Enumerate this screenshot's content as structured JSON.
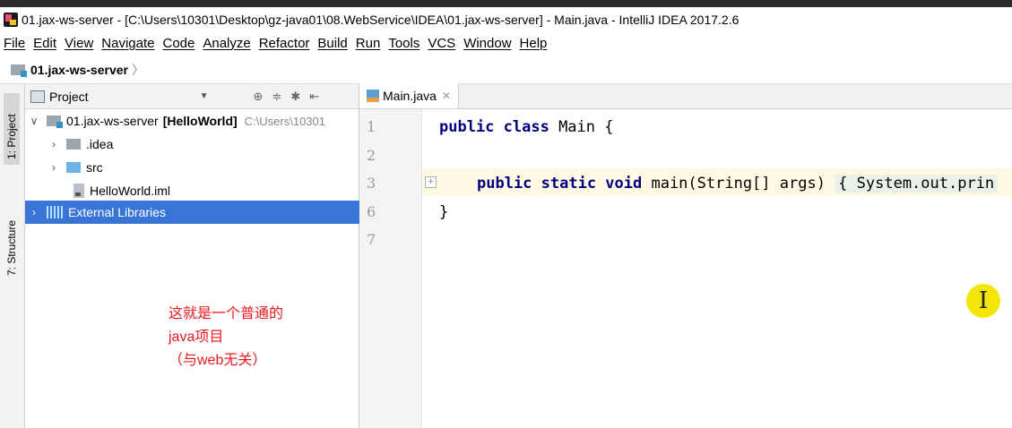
{
  "window": {
    "title": "01.jax-ws-server - [C:\\Users\\10301\\Desktop\\gz-java01\\08.WebService\\IDEA\\01.jax-ws-server] - Main.java - IntelliJ IDEA 2017.2.6"
  },
  "menu": [
    "File",
    "Edit",
    "View",
    "Navigate",
    "Code",
    "Analyze",
    "Refactor",
    "Build",
    "Run",
    "Tools",
    "VCS",
    "Window",
    "Help"
  ],
  "navbar": {
    "crumb": "01.jax-ws-server"
  },
  "left_toolbar": {
    "project_tab": "1: Project",
    "structure_tab": "7: Structure"
  },
  "project_panel": {
    "title": "Project",
    "tree": {
      "root_name": "01.jax-ws-server",
      "root_module": "[HelloWorld]",
      "root_path": "C:\\Users\\10301",
      "idea": ".idea",
      "src": "src",
      "iml": "HelloWorld.iml",
      "libs": "External Libraries"
    }
  },
  "annotation": {
    "line1": "这就是一个普通的",
    "line2": "java项目",
    "line3": "（与web无关）"
  },
  "editor": {
    "tab": "Main.java",
    "line_numbers": [
      "1",
      "2",
      "3",
      "6",
      "7"
    ],
    "code": {
      "l1_kw": "public class",
      "l1_rest": " Main {",
      "l3_kw": "public static void",
      "l3_rest": " main(String[] args) ",
      "l3_fold": "{ System.out.prin",
      "l6": "}"
    }
  },
  "cursor_badge": "I"
}
